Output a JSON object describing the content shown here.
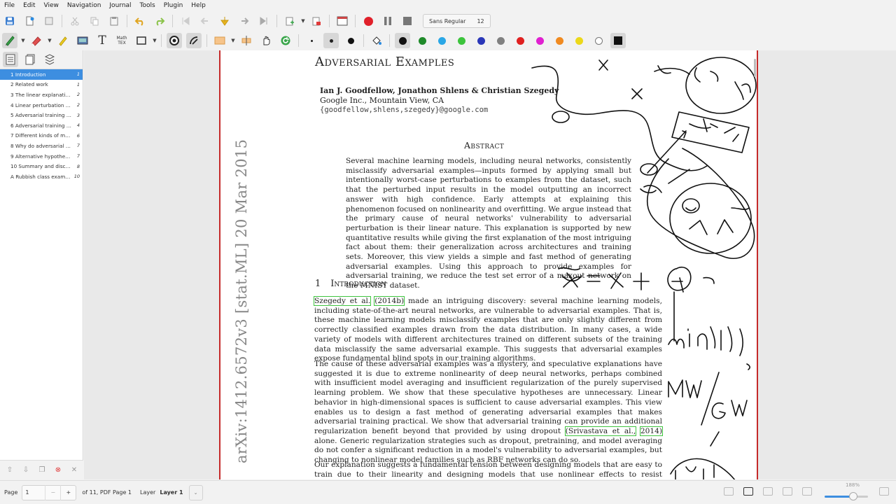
{
  "menu": [
    "File",
    "Edit",
    "View",
    "Navigation",
    "Journal",
    "Tools",
    "Plugin",
    "Help"
  ],
  "toolbar": {
    "font_name": "Sans Regular",
    "font_size": "12",
    "math_label_top": "Math",
    "math_label_bottom": "TEX",
    "text_tool_glyph": "T",
    "colors": [
      "#111111",
      "#1f8a2a",
      "#2aa7e6",
      "#3cc43c",
      "#2a37b8",
      "#808080",
      "#e02020",
      "#e020d0",
      "#f08a20",
      "#ecd81a",
      "#ffffff"
    ]
  },
  "sidebar": {
    "toc": [
      {
        "label": "1 Introduction",
        "page": "1"
      },
      {
        "label": "2 Related work",
        "page": "1"
      },
      {
        "label": "3 The linear explanatio...",
        "page": "2"
      },
      {
        "label": "4 Linear perturbation ...",
        "page": "2"
      },
      {
        "label": "5 Adversarial training o...",
        "page": "3"
      },
      {
        "label": "6 Adversarial training o...",
        "page": "4"
      },
      {
        "label": "7 Different kinds of mo...",
        "page": "6"
      },
      {
        "label": "8 Why do adversarial e...",
        "page": "7"
      },
      {
        "label": "9 Alternative hypotheses",
        "page": "7"
      },
      {
        "label": "10 Summary and discu...",
        "page": "8"
      },
      {
        "label": "A Rubbish class exampl...",
        "page": "10"
      }
    ]
  },
  "paper": {
    "title": "Adversarial Examples",
    "authors": "Ian J. Goodfellow, Jonathon Shlens & Christian Szegedy",
    "affiliation": "Google Inc., Mountain View, CA",
    "email": "{goodfellow,shlens,szegedy}@google.com",
    "abstract_heading": "Abstract",
    "abstract": "Several machine learning models, including neural networks, consistently misclassify adversarial examples—inputs formed by applying small but intentionally worst-case perturbations to examples from the dataset, such that the perturbed input results in the model outputting an incorrect answer with high confidence. Early attempts at explaining this phenomenon focused on nonlinearity and overfitting. We argue instead that the primary cause of neural networks' vulnerability to adversarial perturbation is their linear nature. This explanation is supported by new quantitative results while giving the first explanation of the most intriguing fact about them: their generalization across architectures and training sets. Moreover, this view yields a simple and fast method of generating adversarial examples. Using this approach to provide examples for adversarial training, we reduce the test set error of a maxout network on the MNIST dataset.",
    "arxiv_id": "arXiv:1412.6572v3  [stat.ML]  20 Mar 2015",
    "section_num": "1",
    "section_title": "Introduction",
    "p1_cite_a": "Szegedy et al.",
    "p1_cite_b": "(2014b)",
    "p1_rest": " made an intriguing discovery: several machine learning models, including state-of-the-art neural networks, are vulnerable to adversarial examples. That is, these machine learning models misclassify examples that are only slightly different from correctly classified examples drawn from the data distribution. In many cases, a wide variety of models with different architectures trained on different subsets of the training data misclassify the same adversarial example. This suggests that adversarial examples expose fundamental blind spots in our training algorithms.",
    "p2_start": "The cause of these adversarial examples was a mystery, and speculative explanations have suggested it is due to extreme nonlinearity of deep neural networks, perhaps combined with insufficient model averaging and insufficient regularization of the purely supervised learning problem. We show that these speculative hypotheses are unnecessary. Linear behavior in high-dimensional spaces is sufficient to cause adversarial examples. This view enables us to design a fast method of generating adversarial examples that makes adversarial training practical. We show that adversarial training can provide an additional regularization benefit beyond that provided by using dropout ",
    "p2_cite_a": "(Srivastava et al.,",
    "p2_cite_b": "2014)",
    "p2_end": " alone. Generic regularization strategies such as dropout, pretraining, and model averaging do not confer a significant reduction in a model's vulnerability to adversarial examples, but changing to nonlinear model families such as RBF networks can do so.",
    "p3": "Our explanation suggests a fundamental tension between designing models that are easy to train due to their linearity and designing models that use nonlinear effects to resist adversarial perturbation."
  },
  "status": {
    "page_label": "Page",
    "page_value": "1",
    "page_minus": "−",
    "page_plus": "+",
    "page_of": "of 11, PDF Page 1",
    "layer_label": "Layer",
    "layer_value": "Layer 1",
    "zoom": "188%",
    "zoom_level": 0.66
  }
}
